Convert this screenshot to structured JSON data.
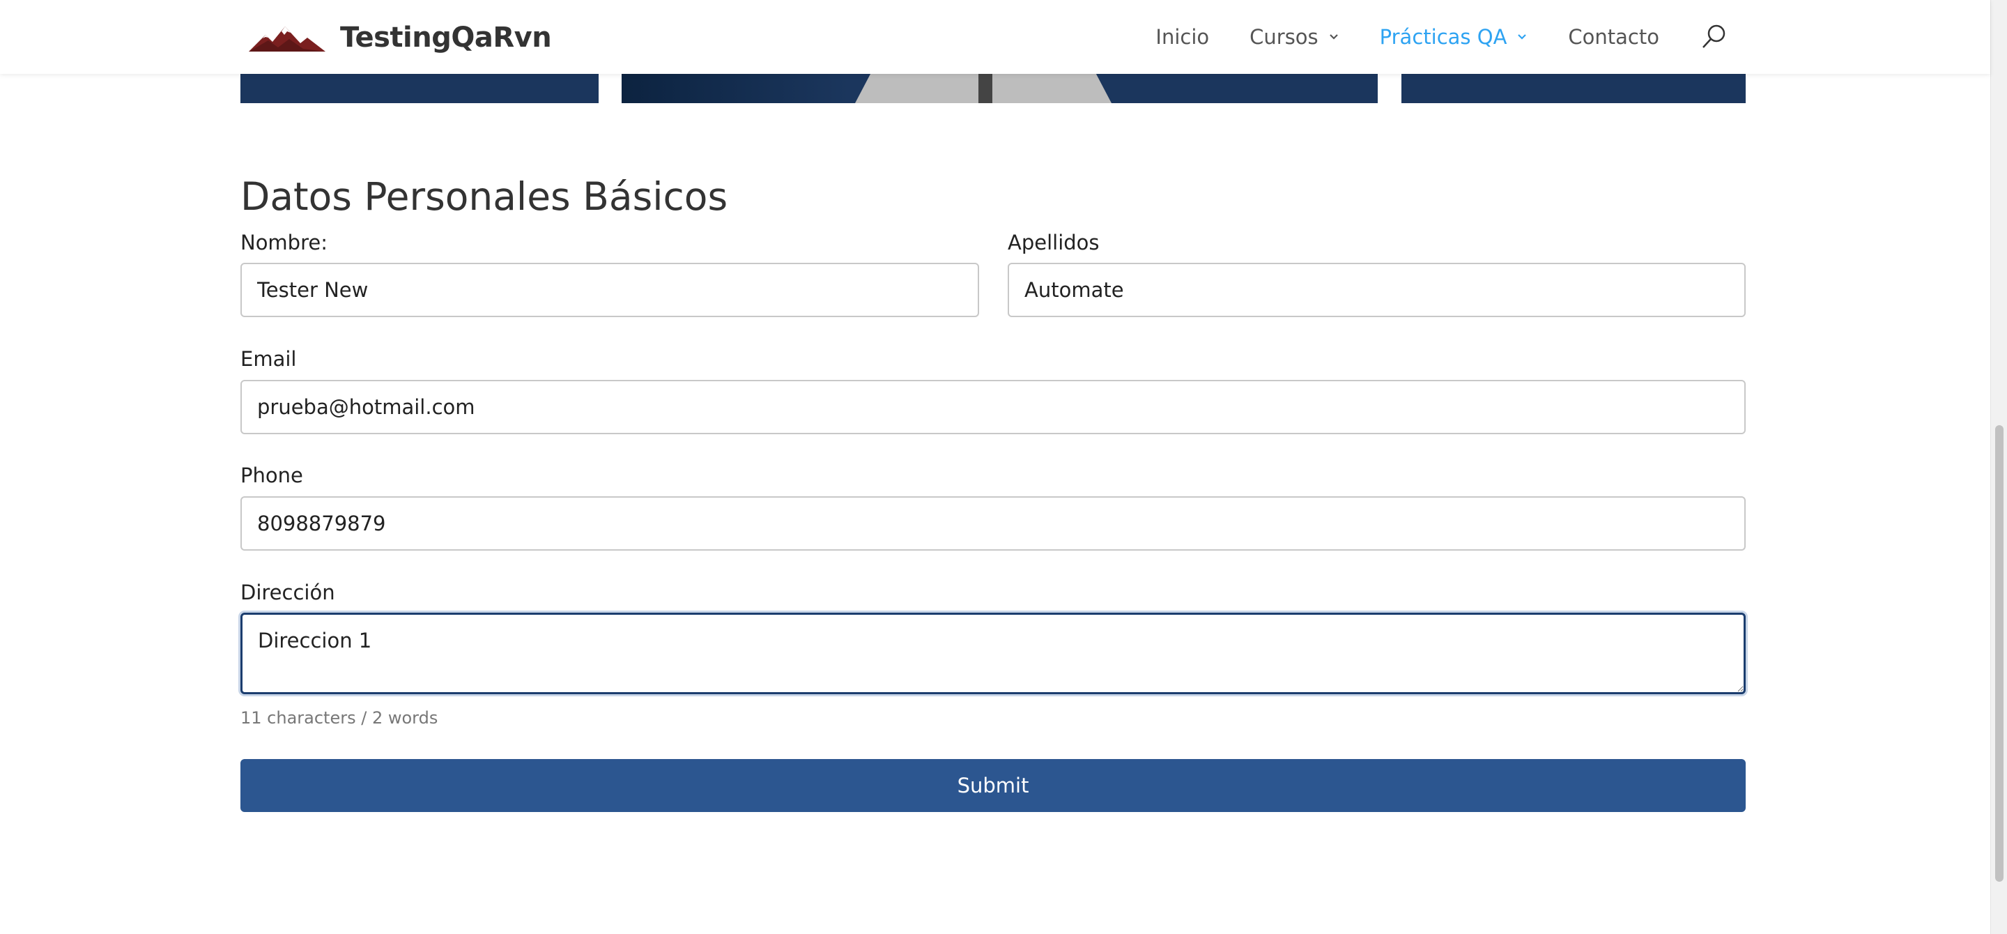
{
  "header": {
    "brand": "TestingQaRvn",
    "nav": [
      {
        "label": "Inicio",
        "has_dropdown": false,
        "active": false
      },
      {
        "label": "Cursos",
        "has_dropdown": true,
        "active": false
      },
      {
        "label": "Prácticas QA",
        "has_dropdown": true,
        "active": true
      },
      {
        "label": "Contacto",
        "has_dropdown": false,
        "active": false
      }
    ],
    "search_icon": "search-icon",
    "accent_color": "#2ea3f2"
  },
  "form": {
    "title": "Datos Personales Básicos",
    "nombre": {
      "label": "Nombre:",
      "value": "Tester New"
    },
    "apellidos": {
      "label": "Apellidos",
      "value": "Automate"
    },
    "email": {
      "label": "Email",
      "value": "prueba@hotmail.com"
    },
    "phone": {
      "label": "Phone",
      "value": "8098879879"
    },
    "direccion": {
      "label": "Dirección",
      "value": "Direccion 1"
    },
    "counter": "11 characters / 2 words",
    "submit_label": "Submit",
    "button_color": "#2c5690"
  }
}
